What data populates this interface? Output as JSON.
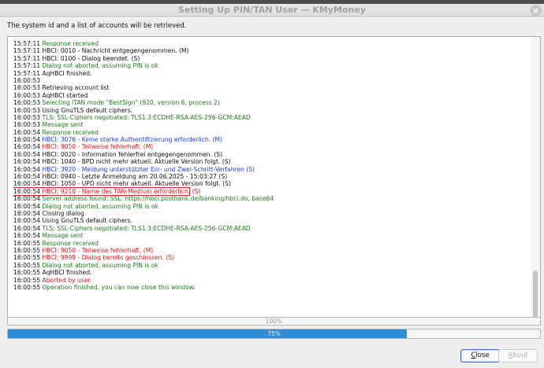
{
  "window": {
    "title": "Setting Up PIN/TAN User — KMyMoney",
    "close_glyph": "×"
  },
  "intro_text": "The system id and a list of accounts will be retrieved.",
  "log": {
    "lines": [
      {
        "time": "15:57:11",
        "msg": "Response received",
        "color": "green"
      },
      {
        "time": "15:57:11",
        "msg": "HBCI: 0010 - Nachricht entgegengenommen. (M)",
        "color": "black"
      },
      {
        "time": "15:57:11",
        "msg": "HBCI: 0100 - Dialog beendet. (S)",
        "color": "black"
      },
      {
        "time": "15:57:11",
        "msg": "Dialog not aborted, assuming PIN is ok",
        "color": "green"
      },
      {
        "time": "15:57:11",
        "msg": "AqHBCI finished.",
        "color": "black"
      },
      {
        "time": "16:00:53",
        "msg": "",
        "color": "black"
      },
      {
        "time": "16:00:53",
        "msg": "Retrieving account list",
        "color": "black"
      },
      {
        "time": "16:00:53",
        "msg": "AqHBCI started",
        "color": "black"
      },
      {
        "time": "16:00:53",
        "msg": "Selecting iTAN mode \"BestSign\" (920, version 6, process 2)",
        "color": "green"
      },
      {
        "time": "16:00:53",
        "msg": "Using GnuTLS default ciphers.",
        "color": "black"
      },
      {
        "time": "16:00:53",
        "msg": "TLS: SSL-Ciphers negotiated: TLS1.3:ECDHE-RSA-AES-256-GCM:AEAD",
        "color": "green"
      },
      {
        "time": "16:00:53",
        "msg": "Message sent",
        "color": "green"
      },
      {
        "time": "16:00:54",
        "msg": "Response received",
        "color": "green"
      },
      {
        "time": "16:00:54",
        "msg": "HBCI: 3076 - Keine starke Authentifizierung erforderlich. (M)",
        "color": "blue"
      },
      {
        "time": "16:00:54",
        "msg": "HBCI: 9050 - Teilweise fehlerhaft. (M)",
        "color": "red"
      },
      {
        "time": "16:00:54",
        "msg": "HBCI: 0020 - Information fehlerfrei entgegengenommen. (S)",
        "color": "black"
      },
      {
        "time": "16:00:54",
        "msg": "HBCI: 1040 - BPD nicht mehr aktuell. Aktuelle Version folgt. (S)",
        "color": "black"
      },
      {
        "time": "16:00:54",
        "msg": "HBCI: 3920 - Meldung unterstützter Ein- und Zwei-Schritt-Verfahren (S)",
        "color": "blue"
      },
      {
        "time": "16:00:54",
        "msg": "HBCI: 0940 - Letzte Anmeldung am 20.06.2025 - 15:03:27 (S)",
        "color": "black"
      },
      {
        "time": "16:00:54",
        "msg": "HBCI: 1050 - UPD nicht mehr aktuell. Aktuelle Version folgt. (S)",
        "color": "black"
      },
      {
        "time": "16:00:54",
        "msg": "HBCI: 9210 - Name des TAN-Medium erforderlich. (S)",
        "color": "red",
        "highlight": true
      },
      {
        "time": "16:00:54",
        "msg": "Server address found: SSL: https://hbci.postbank.de/banking/hbci.do, base64",
        "color": "green"
      },
      {
        "time": "16:00:54",
        "msg": "Dialog not aborted, assuming PIN is ok",
        "color": "green"
      },
      {
        "time": "16:00:54",
        "msg": "Closing dialog",
        "color": "black"
      },
      {
        "time": "16:00:54",
        "msg": "Using GnuTLS default ciphers.",
        "color": "black"
      },
      {
        "time": "16:00:54",
        "msg": "TLS: SSL-Ciphers negotiated: TLS1.3:ECDHE-RSA-AES-256-GCM:AEAD",
        "color": "green"
      },
      {
        "time": "16:00:54",
        "msg": "Message sent",
        "color": "green"
      },
      {
        "time": "16:00:55",
        "msg": "Response received",
        "color": "green"
      },
      {
        "time": "16:00:55",
        "msg": "HBCI: 9050 - Teilweise fehlerhaft. (M)",
        "color": "red"
      },
      {
        "time": "16:00:55",
        "msg": "HBCI: 9999 - Dialog bereits geschlossen. (S)",
        "color": "red"
      },
      {
        "time": "16:00:55",
        "msg": "Dialog not aborted, assuming PIN is ok",
        "color": "green"
      },
      {
        "time": "16:00:55",
        "msg": "AqHBCI finished.",
        "color": "black"
      },
      {
        "time": "16:00:55",
        "msg": "Aborted by user.",
        "color": "red"
      },
      {
        "time": "16:00:55",
        "msg": "Operation finished, you can now close this window.",
        "color": "green"
      }
    ]
  },
  "progress_overall": {
    "label": "100%",
    "value": 1.0
  },
  "progress_current": {
    "label": "75%",
    "value": 0.75
  },
  "buttons": {
    "close_first": "C",
    "close_rest": "lose",
    "about_first": "A",
    "about_rest": "bout"
  },
  "colors": {
    "green": "#207a1c",
    "blue": "#1f3fd6",
    "red": "#d41e1e",
    "progress_fill": "#2f8bd6",
    "highlight_box": "#d42a2a"
  }
}
